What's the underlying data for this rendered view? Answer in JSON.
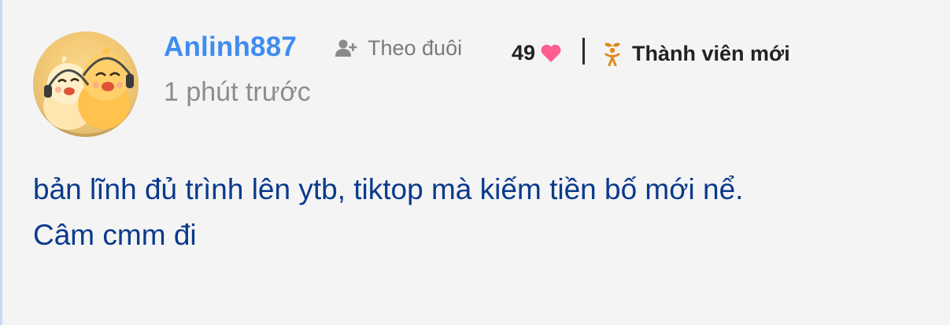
{
  "comment": {
    "author": {
      "username": "Anlinh887",
      "avatar_icon": "avatar-ducks-with-headphones"
    },
    "follow": {
      "label": "Theo đuôi",
      "icon": "add-user-icon"
    },
    "likes": {
      "count": "49",
      "icon": "heart-icon",
      "color": "#ff5d8f"
    },
    "rank": {
      "label": "Thành viên mới",
      "icon": "sprout-person-icon",
      "color": "#e08a1e"
    },
    "timestamp": "1 phút trước",
    "text_lines": [
      "bản lĩnh đủ trình lên ytb, tiktop mà kiếm tiền bố mới nể.",
      "Câm cmm đi"
    ]
  },
  "colors": {
    "username": "#3f8cf0",
    "body_text": "#0a3a8c",
    "background": "#f4f4f5"
  }
}
